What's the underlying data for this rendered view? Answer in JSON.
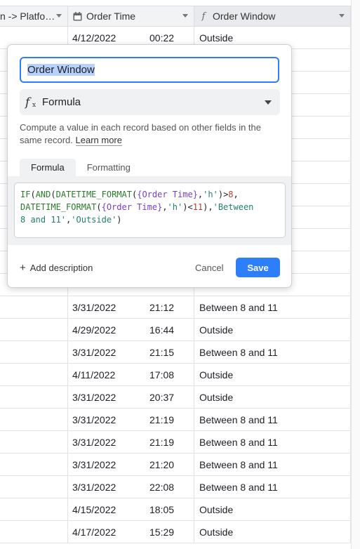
{
  "header": {
    "col1_label": "n -> Platfo…",
    "col2_label": "Order Time",
    "col3_label": "Order Window"
  },
  "rows": [
    {
      "date": "4/12/2022",
      "time": "00:22",
      "window": "Outside"
    },
    {
      "date": "",
      "time": "",
      "window": ""
    },
    {
      "date": "",
      "time": "",
      "window": ""
    },
    {
      "date": "",
      "time": "",
      "window": ""
    },
    {
      "date": "",
      "time": "",
      "window": ""
    },
    {
      "date": "",
      "time": "",
      "window": ""
    },
    {
      "date": "",
      "time": "",
      "window": ""
    },
    {
      "date": "",
      "time": "",
      "window": ""
    },
    {
      "date": "",
      "time": "",
      "window": ""
    },
    {
      "date": "",
      "time": "",
      "window": ""
    },
    {
      "date": "",
      "time": "",
      "window": ""
    },
    {
      "date": "",
      "time": "",
      "window": ""
    },
    {
      "date": "3/31/2022",
      "time": "21:12",
      "window": "Between 8 and 11"
    },
    {
      "date": "4/29/2022",
      "time": "16:44",
      "window": "Outside"
    },
    {
      "date": "3/31/2022",
      "time": "21:15",
      "window": "Between 8 and 11"
    },
    {
      "date": "4/11/2022",
      "time": "17:08",
      "window": "Outside"
    },
    {
      "date": "3/31/2022",
      "time": "20:37",
      "window": "Outside"
    },
    {
      "date": "3/31/2022",
      "time": "21:19",
      "window": "Between 8 and 11"
    },
    {
      "date": "3/31/2022",
      "time": "21:19",
      "window": "Between 8 and 11"
    },
    {
      "date": "3/31/2022",
      "time": "21:20",
      "window": "Between 8 and 11"
    },
    {
      "date": "3/31/2022",
      "time": "22:08",
      "window": "Between 8 and 11"
    },
    {
      "date": "4/15/2022",
      "time": "18:05",
      "window": "Outside"
    },
    {
      "date": "4/17/2022",
      "time": "15:29",
      "window": "Outside"
    }
  ],
  "dialog": {
    "field_name": "Order Window",
    "field_type": "Formula",
    "description_text": "Compute a value in each record based on other fields in the same record.",
    "learn_more": "Learn more",
    "tab_formula": "Formula",
    "tab_formatting": "Formatting",
    "formula": "IF(AND(DATETIME_FORMAT({Order Time},'h')>8,\nDATETIME_FORMAT({Order Time},'h')<11),'Between\n8 and 11','Outside')",
    "add_description": "Add description",
    "cancel": "Cancel",
    "save": "Save"
  },
  "colors": {
    "accent": "#2d7ff9",
    "selection": "#b7d1fb"
  },
  "icons": {
    "col2": "calendar-icon",
    "col3": "formula-fx-icon",
    "type": "formula-fx-icon"
  }
}
